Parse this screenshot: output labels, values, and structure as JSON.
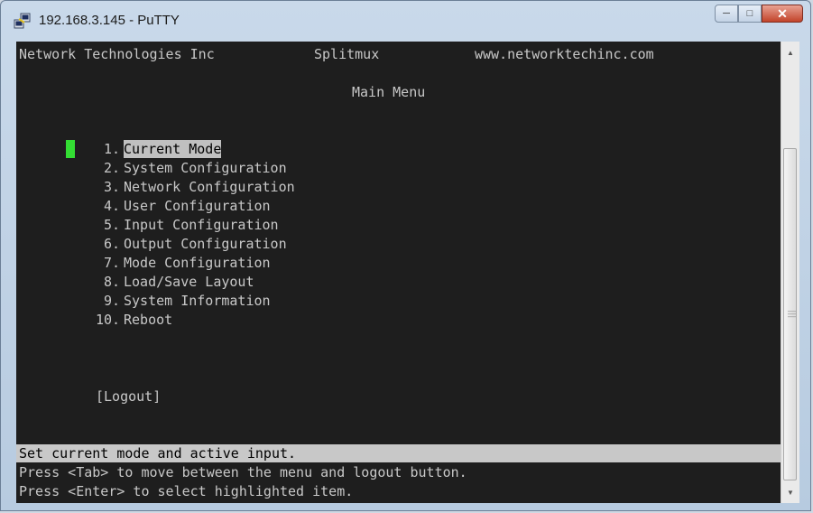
{
  "window": {
    "title": "192.168.3.145 - PuTTY"
  },
  "header": {
    "company": "Network Technologies Inc",
    "product": "Splitmux",
    "url": "www.networktechinc.com"
  },
  "menu": {
    "title": "Main Menu",
    "items": [
      {
        "number": " 1.",
        "label": "Current Mode"
      },
      {
        "number": " 2.",
        "label": "System Configuration"
      },
      {
        "number": " 3.",
        "label": "Network Configuration"
      },
      {
        "number": " 4.",
        "label": "User Configuration"
      },
      {
        "number": " 5.",
        "label": "Input Configuration"
      },
      {
        "number": " 6.",
        "label": "Output Configuration"
      },
      {
        "number": " 7.",
        "label": "Mode Configuration"
      },
      {
        "number": " 8.",
        "label": "Load/Save Layout"
      },
      {
        "number": " 9.",
        "label": "System Information"
      },
      {
        "number": "10.",
        "label": "Reboot"
      }
    ],
    "selected_index": 0,
    "logout": "[Logout]"
  },
  "footer": {
    "status": "Set current mode and active input.",
    "help1": "Press <Tab> to move between the menu and logout button.",
    "help2": "Press <Enter> to select highlighted item."
  },
  "colors": {
    "cursor": "#33dd33",
    "terminal_bg": "#1e1e1e",
    "text": "#c8c8c8",
    "highlight_bg": "#c0c0c0"
  },
  "icons": {
    "app": "putty-icon",
    "minimize": "minimize-icon",
    "maximize": "maximize-icon",
    "close": "close-icon",
    "scroll_up": "scroll-up-icon",
    "scroll_down": "scroll-down-icon"
  }
}
